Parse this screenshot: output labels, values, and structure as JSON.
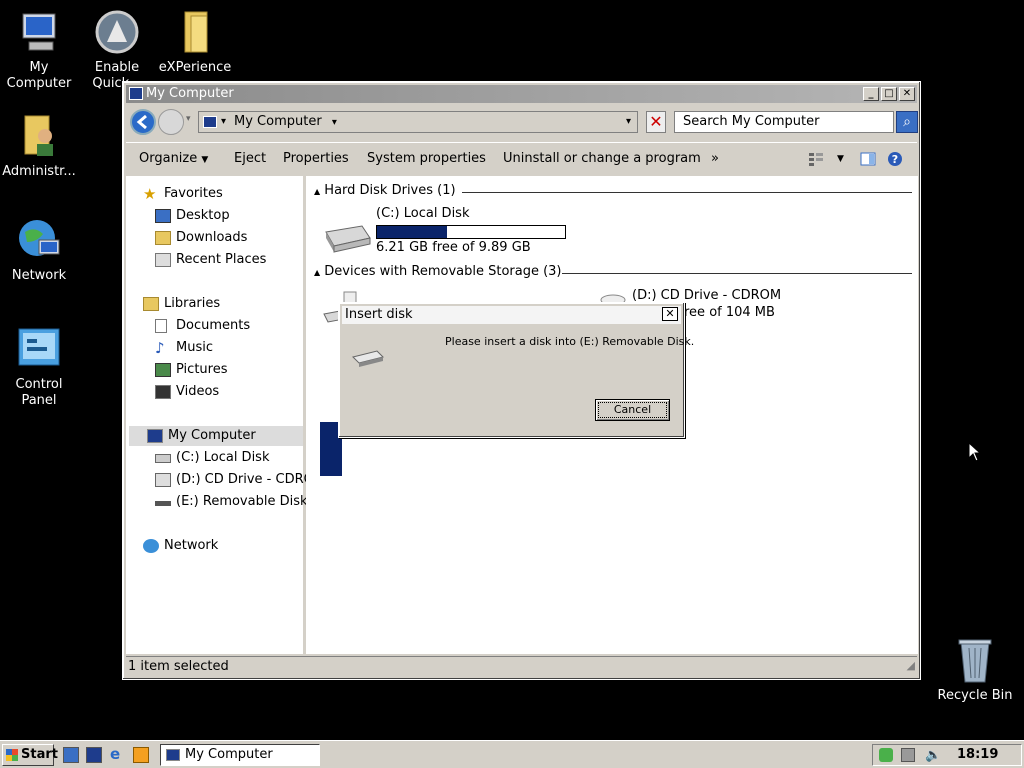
{
  "desktop": {
    "icons": [
      {
        "label": "My Computer"
      },
      {
        "label": "Enable Quick..."
      },
      {
        "label": "eXPerience"
      },
      {
        "label": "Administr..."
      },
      {
        "label": "Network"
      },
      {
        "label": "Control Panel"
      },
      {
        "label": "Recycle Bin"
      }
    ]
  },
  "window": {
    "title": "My Computer",
    "address": "My Computer",
    "search_placeholder": "Search My Computer",
    "commands": {
      "organize": "Organize",
      "eject": "Eject",
      "properties": "Properties",
      "system_properties": "System properties",
      "uninstall": "Uninstall or change a program",
      "more": "»"
    },
    "nav": {
      "favorites": "Favorites",
      "desktop": "Desktop",
      "downloads": "Downloads",
      "recent_places": "Recent Places",
      "libraries": "Libraries",
      "documents": "Documents",
      "music": "Music",
      "pictures": "Pictures",
      "videos": "Videos",
      "my_computer": "My Computer",
      "c_drive": "(C:) Local Disk",
      "d_drive": "(D:) CD Drive - CDROM",
      "e_drive": "(E:) Removable Disk",
      "network": "Network"
    },
    "content": {
      "group_hdd": "Hard Disk Drives (1)",
      "group_removable": "Devices with Removable Storage (3)",
      "c_name": "(C:) Local Disk",
      "c_free": "6.21 GB free of 9.89 GB",
      "c_used_fraction": 0.37,
      "d_name": "(D:) CD Drive - CDROM",
      "d_free": "ree of 104 MB"
    },
    "status": "1 item selected"
  },
  "dialog": {
    "title": "Insert disk",
    "message": "Please insert a disk into (E:) Removable Disk.",
    "cancel": "Cancel",
    "close": "✕"
  },
  "taskbar": {
    "start": "Start",
    "task": "My Computer",
    "clock": "18:19"
  },
  "colors": {
    "desktop": "#000000",
    "selection": "#0a246a",
    "progress": "#0a246a"
  }
}
